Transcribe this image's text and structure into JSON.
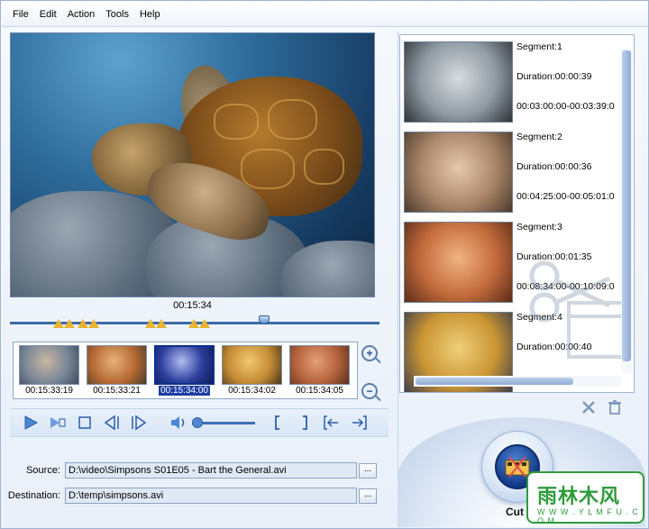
{
  "menu": [
    "File",
    "Edit",
    "Action",
    "Tools",
    "Help"
  ],
  "player": {
    "current_time": "00:15:34",
    "timeline_position": 0.69
  },
  "thumbnails": [
    {
      "time": "00:15:33:19",
      "colors": [
        "#7a8797",
        "#c8b7a3",
        "#3b4b5c"
      ],
      "selected": false
    },
    {
      "time": "00:15:33:21",
      "colors": [
        "#b66a34",
        "#e6b27a",
        "#4a3a2c"
      ],
      "selected": false
    },
    {
      "time": "00:15:34:00",
      "colors": [
        "#2c3f9c",
        "#b2bbf2",
        "#0e1a55"
      ],
      "selected": true
    },
    {
      "time": "00:15:34:02",
      "colors": [
        "#c48b35",
        "#f0c870",
        "#4a3618"
      ],
      "selected": false
    },
    {
      "time": "00:15:34:05",
      "colors": [
        "#b4623c",
        "#e3a07a",
        "#5c2e1c"
      ],
      "selected": false
    }
  ],
  "controls": {
    "volume": 0.0
  },
  "fields": {
    "source_label": "Source:",
    "source_value": "D:\\video\\Simpsons S01E05 - Bart the General.avi",
    "destination_label": "Destination:",
    "destination_value": "D:\\temp\\simpsons.avi",
    "browse_label": "..."
  },
  "segments": [
    {
      "title": "Segment:1",
      "duration": "Duration:00:00:39",
      "range": "00:03:00:00-00:03:39:0",
      "colors": [
        "#8f9aa3",
        "#d8dcdf",
        "#2e3338"
      ]
    },
    {
      "title": "Segment:2",
      "duration": "Duration:00:00:36",
      "range": "00:04:25:00-00:05:01:0",
      "colors": [
        "#a88568",
        "#e7c8aa",
        "#4b3a2c"
      ]
    },
    {
      "title": "Segment:3",
      "duration": "Duration:00:01:35",
      "range": "00:08:34:00-00:10:09:0",
      "colors": [
        "#c26a3c",
        "#f1b381",
        "#5a2c18"
      ]
    },
    {
      "title": "Segment:4",
      "duration": "Duration:00:00:40",
      "range": "",
      "colors": [
        "#c99533",
        "#f0cf7a",
        "#3d3d4a"
      ]
    }
  ],
  "cut": {
    "label": "Cut"
  },
  "watermark": {
    "text": "雨林木风",
    "url": "W W W . Y L M F U . C O M"
  }
}
